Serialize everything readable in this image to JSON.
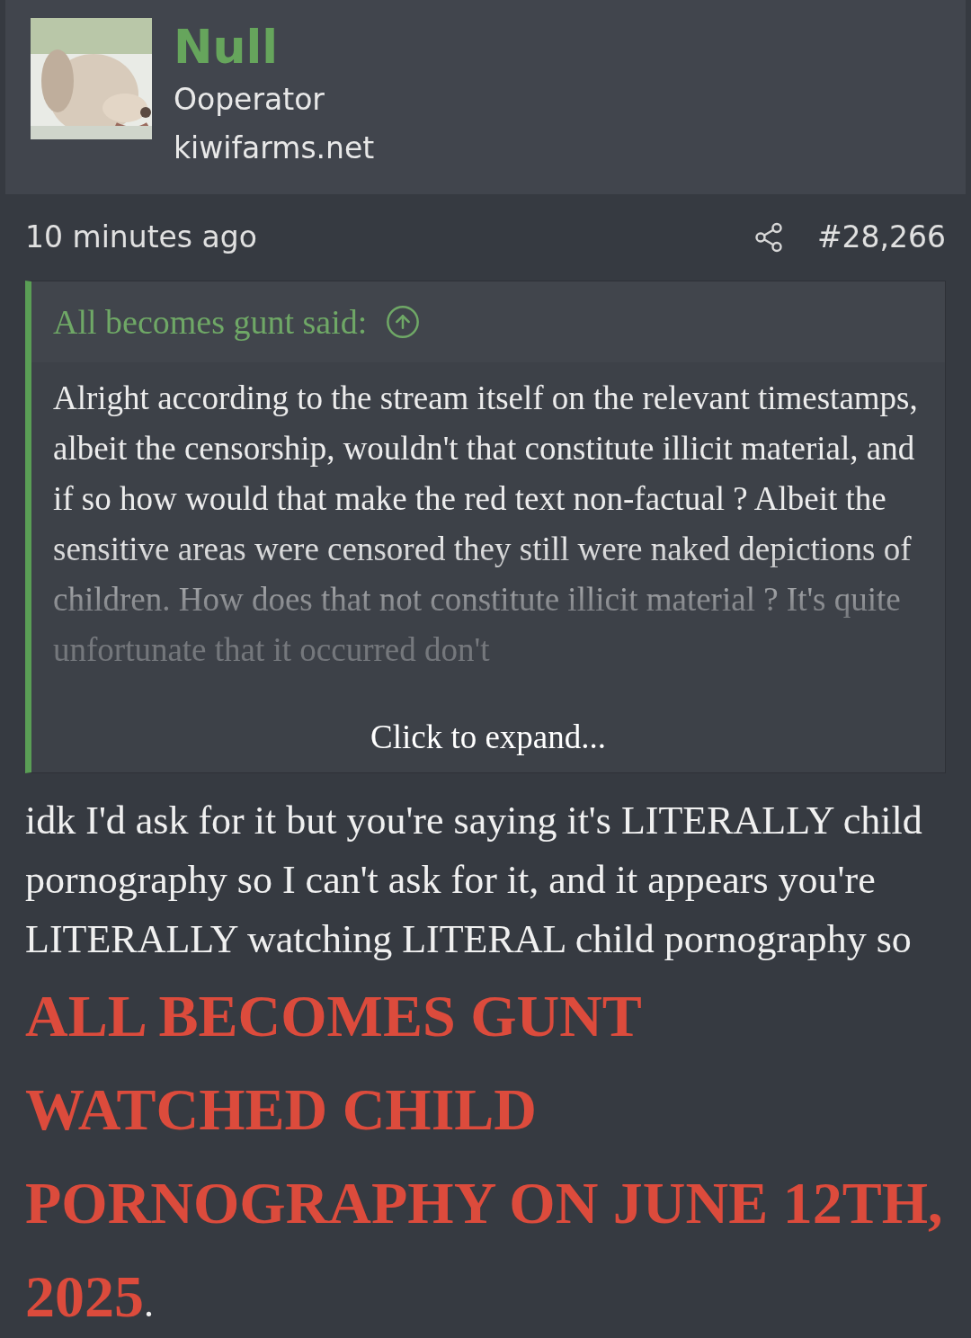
{
  "author": {
    "name": "Null",
    "role": "Ooperator",
    "site": "kiwifarms.net"
  },
  "post": {
    "time": "10 minutes ago",
    "number": "#28,266"
  },
  "quote": {
    "attribution": "All becomes gunt said:",
    "text": "Alright according to the stream itself on the relevant timestamps, albeit the censorship, wouldn't that constitute illicit material, and if so how would that make the red text non-factual ? Albeit the sensitive areas were censored they still were naked depictions of children. How does that not constitute illicit material ? It's quite unfortunate that it occurred don't",
    "expand": "Click to expand..."
  },
  "body": [
    {
      "kind": "plain",
      "text": "idk I'd ask for it but you're saying it's LITERALLY child pornography so I can't ask for it, and it appears you're LITERALLY watching LITERAL child pornography so "
    },
    {
      "kind": "shout",
      "text": "ALL BECOMES GUNT WATCHED CHILD PORNOGRAPHY ON JUNE 12TH, 2025"
    },
    {
      "kind": "plain",
      "text": "."
    }
  ]
}
